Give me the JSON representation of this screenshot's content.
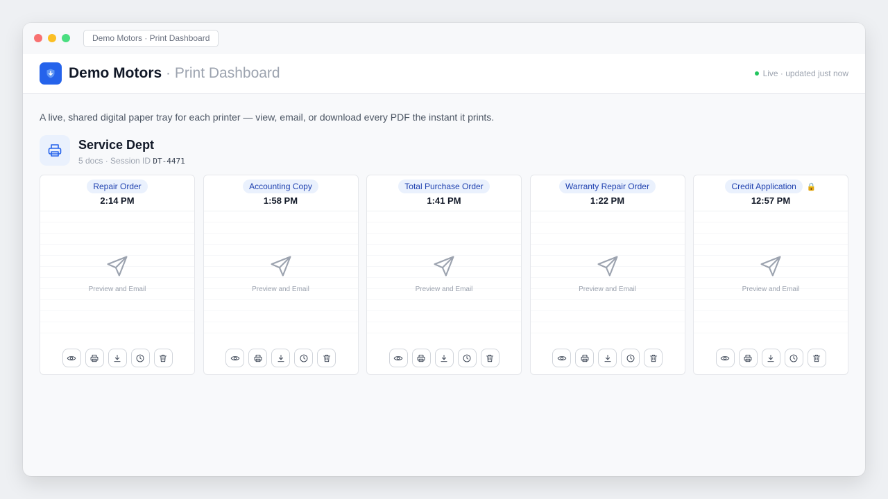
{
  "window": {
    "url_label": "Demo Motors · Print Dashboard"
  },
  "header": {
    "brand_name": "Demo Motors",
    "separator": " · ",
    "brand_sub": "Print Dashboard",
    "live_status": "Live · updated just now"
  },
  "intro": "A live, shared digital paper tray for each printer — view, email, or download every PDF the instant it prints.",
  "department": {
    "title": "Service Dept",
    "meta_prefix": "5 docs · Session ID ",
    "session_id": "DT-4471"
  },
  "preview_label": "Preview and Email",
  "documents": [
    {
      "type": "Repair Order",
      "time": "2:14 PM",
      "locked": false
    },
    {
      "type": "Accounting Copy",
      "time": "1:58 PM",
      "locked": false
    },
    {
      "type": "Total Purchase Order",
      "time": "1:41 PM",
      "locked": false
    },
    {
      "type": "Warranty Repair Order",
      "time": "1:22 PM",
      "locked": false
    },
    {
      "type": "Credit Application",
      "time": "12:57 PM",
      "locked": true,
      "lock_glyph": "🔒"
    }
  ],
  "actions": [
    "eye-icon",
    "printer-icon",
    "download-icon",
    "clock-icon",
    "trash-icon"
  ],
  "colors": {
    "accent": "#2563eb",
    "tag_bg": "#eaf1fd",
    "tag_text": "#1e40af",
    "live": "#22c55e"
  }
}
